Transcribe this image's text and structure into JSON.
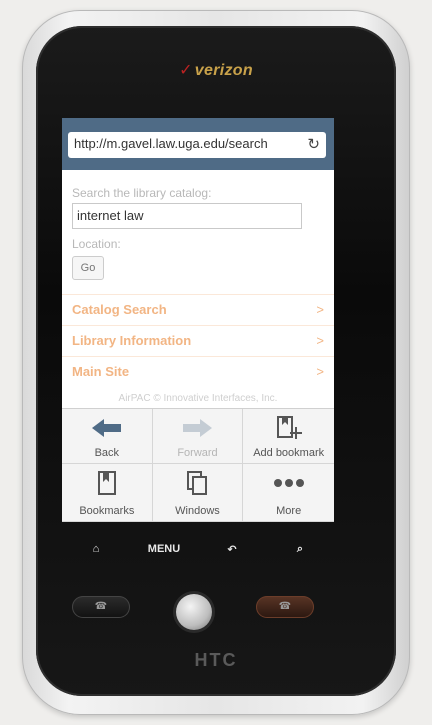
{
  "device": {
    "carrier": "verizon",
    "brand": "HTC",
    "nav_keys": [
      {
        "icon": "home-icon",
        "label": ""
      },
      {
        "icon": "menu-key",
        "label": "MENU"
      },
      {
        "icon": "back-arrow-icon",
        "label": ""
      },
      {
        "icon": "search-icon",
        "label": ""
      }
    ]
  },
  "browser": {
    "url": "http://m.gavel.law.uga.edu/search",
    "reload_icon": "reload-icon"
  },
  "page": {
    "search_label": "Search the library catalog:",
    "search_value": "internet law",
    "location_label": "Location:",
    "go_label": "Go",
    "links": [
      {
        "label": "Catalog Search",
        "chevron": ">"
      },
      {
        "label": "Library Information",
        "chevron": ">"
      },
      {
        "label": "Main Site",
        "chevron": ">"
      }
    ],
    "footer": "AirPAC © Innovative Interfaces, Inc."
  },
  "menu": {
    "items": [
      {
        "label": "Back",
        "icon": "back-arrow-icon",
        "enabled": true
      },
      {
        "label": "Forward",
        "icon": "forward-arrow-icon",
        "enabled": false
      },
      {
        "label": "Add bookmark",
        "icon": "add-bookmark-icon",
        "enabled": true
      },
      {
        "label": "Bookmarks",
        "icon": "bookmarks-icon",
        "enabled": true
      },
      {
        "label": "Windows",
        "icon": "windows-icon",
        "enabled": true
      },
      {
        "label": "More",
        "icon": "more-icon",
        "enabled": true
      }
    ]
  },
  "colors": {
    "url_bar": "#4f6b86",
    "link_text": "#f2b584",
    "menu_bg": "#f1f1f1",
    "back_arrow": "#4f6b86"
  }
}
